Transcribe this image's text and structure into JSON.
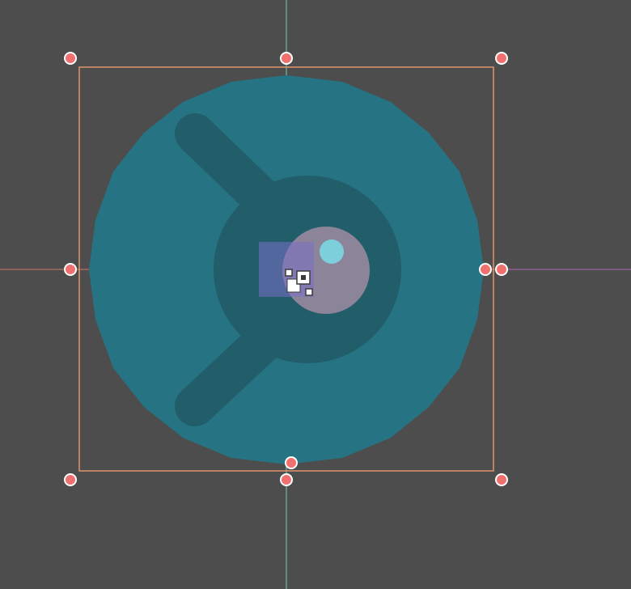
{
  "viewport": {
    "background_color": "#4d4d4d",
    "axis_x_color": "#e0806b",
    "axis_y_color": "#7fd6c8",
    "axis_x_end_color": "#c070c8"
  },
  "node": {
    "name_icon": "godot-sprite-icon",
    "body_color": "#267383",
    "shadow_color": "#225e6a",
    "eye_color": "#8c8498",
    "pupil_color": "#7ecfdc"
  },
  "selection": {
    "outline_color": "#e0946b",
    "handle_fill": "#f07070",
    "handle_stroke": "#ffffff"
  },
  "pivot": {
    "rect_color": "#7a70c8",
    "icon": "pivot-icon"
  }
}
